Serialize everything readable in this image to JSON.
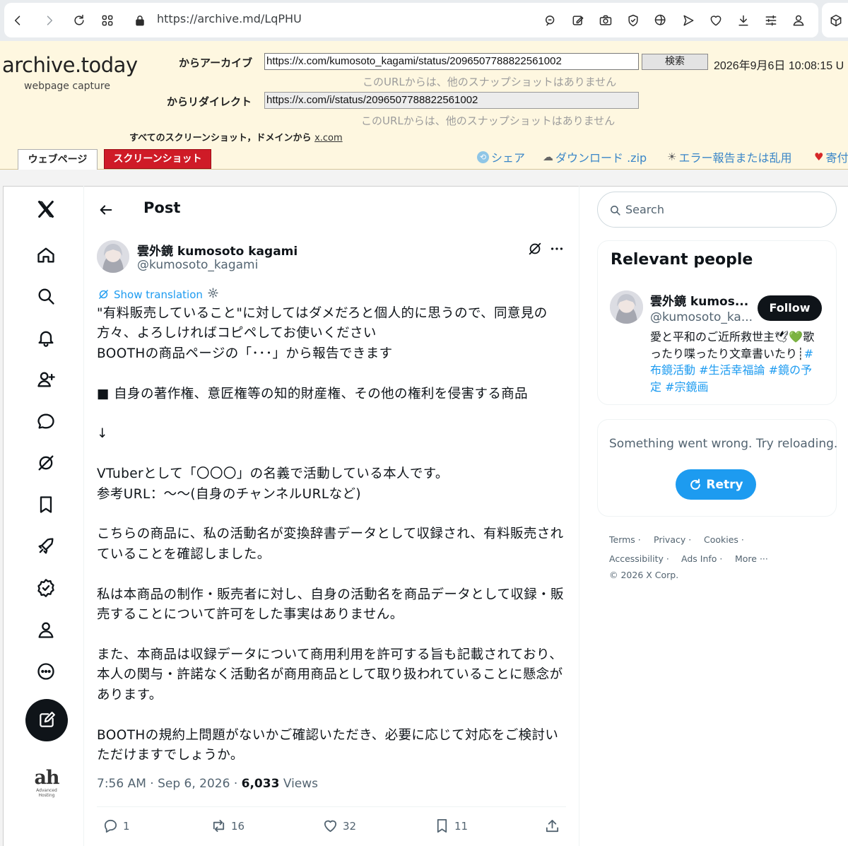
{
  "browser": {
    "url_prefix": "https://",
    "url_domain": "archive.md",
    "url_path": "/LqPHU"
  },
  "archive": {
    "logo": "archive.today",
    "logo_sub": "webpage capture",
    "archived_from_label": "からアーカイブ",
    "archived_from_url": "https://x.com/kumosoto_kagami/status/2096507788822561002",
    "search_button": "検索",
    "timestamp": "2026年9月6日 10:08:15 U",
    "no_other_snapshots_1": "このURLからは、他のスナップショットはありません",
    "redirected_from_label": "からリダイレクト",
    "redirected_from_url": "https://x.com/i/status/2096507788822561002",
    "no_other_snapshots_2": "このURLからは、他のスナップショットはありません",
    "all_screenshots_prefix": "すべてのスクリーンショット，ドメインから",
    "all_screenshots_domain": "x.com",
    "tab_webpage": "ウェブページ",
    "tab_screenshot": "スクリーンショット",
    "link_share": "シェア",
    "link_download": "ダウンロード .zip",
    "link_report": "エラー報告または乱用",
    "link_donate": "寄付"
  },
  "post": {
    "header_title": "Post",
    "author_name": "雲外鏡 kumosoto kagami",
    "author_handle": "@kumosoto_kagami",
    "show_translation": "Show translation",
    "body": "\"有料販売していること\"に対してはダメだろと個人的に思うので、同意見の方々、よろしければコピペしてお使いください\nBOOTHの商品ページの「･･･」から報告できます\n\n■ 自身の著作権、意匠権等の知的財産権、その他の権利を侵害する商品\n\n↓\n\nVTuberとして「〇〇〇」の名義で活動している本人です。\n参考URL：〜〜(自身のチャンネルURLなど)\n\nこちらの商品に、私の活動名が変換辞書データとして収録され、有料販売されていることを確認しました。\n\n私は本商品の制作・販売者に対し、自身の活動名を商品データとして収録・販売することについて許可をした事実はありません。\n\nまた、本商品は収録データについて商用利用を許可する旨も記載されており、本人の関与・許諾なく活動名が商用商品として取り扱われていることに懸念があります。\n\nBOOTHの規約上問題がないかご確認いただき、必要に応じて対応をご検討いただけますでしょうか。",
    "time": "7:56 AM · Sep 6, 2026 · ",
    "views_count": "6,033",
    "views_label": " Views",
    "replies": "1",
    "reposts": "16",
    "likes": "32",
    "bookmarks": "11"
  },
  "right": {
    "search_placeholder": "Search",
    "relevant_title": "Relevant people",
    "person_name": "雲外鏡 kumos...",
    "person_handle": "@kumosoto_ka...",
    "follow_label": "Follow",
    "bio_text": "愛と平和のご近所救世主🕊💚歌ったり喋ったり文章書いたり┊",
    "bio_tags": "#布鏡活動 #生活幸福論 #鏡の予定 #宗鏡画",
    "error_text": "Something went wrong. Try reloading.",
    "retry_label": "Retry",
    "footer": {
      "terms": "Terms",
      "privacy": "Privacy",
      "cookies": "Cookies",
      "accessibility": "Accessibility",
      "ads_info": "Ads Info",
      "more": "More ···",
      "copyright": "© 2026 X Corp."
    }
  },
  "sidebar_logo": {
    "big": "ah",
    "small": "Advanced Hosting"
  },
  "colors": {
    "accent": "#1d9bf0",
    "archive_bg": "#fef7e0",
    "archive_red": "#cf1b27"
  }
}
